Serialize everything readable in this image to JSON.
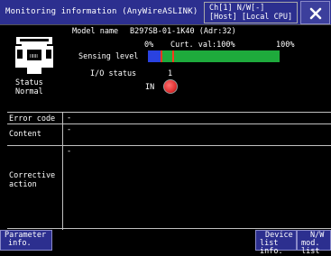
{
  "window": {
    "title": "Monitoring information (AnyWireASLINK)",
    "channel_line1": "Ch[1]  N/W[-]",
    "channel_line2": "[Host]  [Local CPU]",
    "close_icon": "close-icon"
  },
  "device": {
    "icon": "module-icon",
    "status_label": "Status",
    "status_value": "Normal",
    "model_label": "Model name",
    "model_value": "B297SB-01-1K40 (Adr:32)",
    "scale_min": "0%",
    "curt_val": "Curt. val:100%",
    "scale_max": "100%",
    "sensing_label": "Sensing level",
    "sensing_level_percent": 100,
    "io_label": "I/O status",
    "io_number": "1",
    "io_dir": "IN",
    "lamp_color": "#e03030"
  },
  "details": {
    "error_code_label": "Error code",
    "error_code_value": "-",
    "content_label": "Content",
    "content_value": "-",
    "corrective_label_1": "Corrective",
    "corrective_label_2": "action",
    "corrective_value": "-"
  },
  "buttons": {
    "parameter_1": "Parameter",
    "parameter_2": "info.",
    "device_1": "Device",
    "device_2": "list info.",
    "nw_1": "N/W",
    "nw_2": "mod. list"
  }
}
